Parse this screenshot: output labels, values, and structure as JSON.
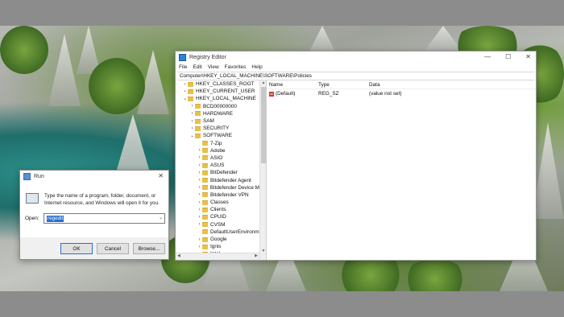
{
  "registry_editor": {
    "title": "Registry Editor",
    "menu": [
      "File",
      "Edit",
      "View",
      "Favorites",
      "Help"
    ],
    "address": "Computer\\HKEY_LOCAL_MACHINE\\SOFTWARE\\Policies",
    "tree": [
      {
        "label": "HKEY_CLASSES_ROOT",
        "level": 0,
        "expander": ">"
      },
      {
        "label": "HKEY_CURRENT_USER",
        "level": 0,
        "expander": ">"
      },
      {
        "label": "HKEY_LOCAL_MACHINE",
        "level": 0,
        "expander": "v"
      },
      {
        "label": "BCD00000000",
        "level": 1,
        "expander": ">"
      },
      {
        "label": "HARDWARE",
        "level": 1,
        "expander": ">"
      },
      {
        "label": "SAM",
        "level": 1,
        "expander": ">"
      },
      {
        "label": "SECURITY",
        "level": 1,
        "expander": ">"
      },
      {
        "label": "SOFTWARE",
        "level": 1,
        "expander": "v"
      },
      {
        "label": "7-Zip",
        "level": 2,
        "expander": ""
      },
      {
        "label": "Adobe",
        "level": 2,
        "expander": ">"
      },
      {
        "label": "ASIO",
        "level": 2,
        "expander": ">"
      },
      {
        "label": "ASUS",
        "level": 2,
        "expander": ">"
      },
      {
        "label": "BitDefender",
        "level": 2,
        "expander": ">"
      },
      {
        "label": "Bitdefender Agent",
        "level": 2,
        "expander": ">"
      },
      {
        "label": "Bitdefender Device M",
        "level": 2,
        "expander": ">"
      },
      {
        "label": "Bitdefender VPN",
        "level": 2,
        "expander": ">"
      },
      {
        "label": "Classes",
        "level": 2,
        "expander": ">"
      },
      {
        "label": "Clients",
        "level": 2,
        "expander": ">"
      },
      {
        "label": "CPUID",
        "level": 2,
        "expander": ">"
      },
      {
        "label": "CVSM",
        "level": 2,
        "expander": ">"
      },
      {
        "label": "DefaultUserEnvironm",
        "level": 2,
        "expander": ""
      },
      {
        "label": "Google",
        "level": 2,
        "expander": ">"
      },
      {
        "label": "Ignis",
        "level": 2,
        "expander": ">"
      },
      {
        "label": "Intel",
        "level": 2,
        "expander": ">"
      }
    ],
    "columns": [
      "Name",
      "Type",
      "Data"
    ],
    "rows": [
      {
        "name": "(Default)",
        "type": "REG_SZ",
        "data": "(value not set)",
        "icon": "ab-icon"
      }
    ],
    "window_controls": [
      "—",
      "☐",
      "✕"
    ]
  },
  "run_dialog": {
    "title": "Run",
    "close": "✕",
    "description": "Type the name of a program, folder, document, or Internet resource, and Windows will open it for you.",
    "open_label": "Open:",
    "input_value": "regedit",
    "buttons": {
      "ok": "OK",
      "cancel": "Cancel",
      "browse": "Browse..."
    }
  },
  "colors": {
    "selection": "#2a6ecf",
    "folder": "#e8c14a"
  }
}
